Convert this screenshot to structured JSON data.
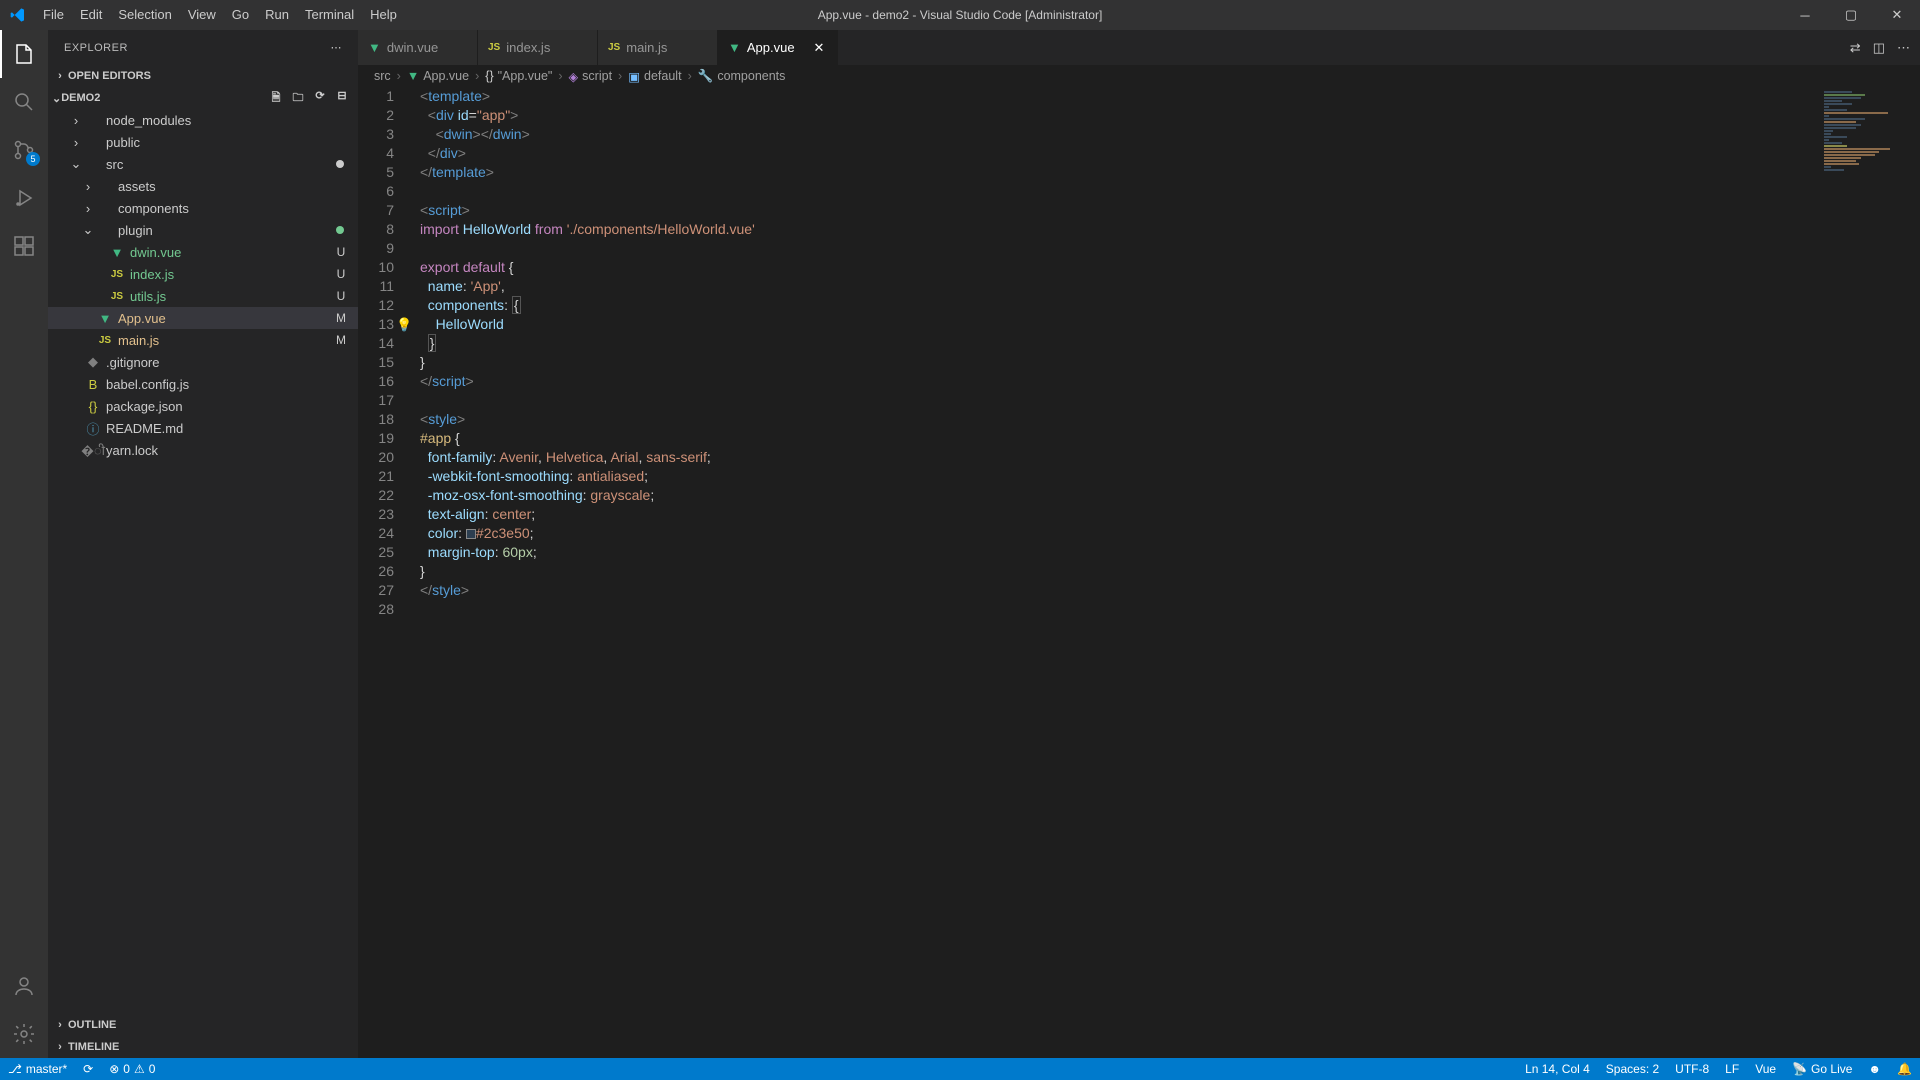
{
  "titlebar": {
    "title": "App.vue - demo2 - Visual Studio Code [Administrator]"
  },
  "menu": [
    "File",
    "Edit",
    "Selection",
    "View",
    "Go",
    "Run",
    "Terminal",
    "Help"
  ],
  "activity": {
    "scm_badge": "5"
  },
  "sidebar": {
    "title": "EXPLORER",
    "sections": {
      "open_editors": "OPEN EDITORS",
      "outline": "OUTLINE",
      "timeline": "TIMELINE"
    },
    "project": "DEMO2",
    "tree": [
      {
        "indent": 1,
        "type": "folder",
        "expanded": false,
        "label": "node_modules"
      },
      {
        "indent": 1,
        "type": "folder",
        "expanded": false,
        "label": "public"
      },
      {
        "indent": 1,
        "type": "folder",
        "expanded": true,
        "label": "src",
        "dot": true
      },
      {
        "indent": 2,
        "type": "folder",
        "expanded": false,
        "label": "assets"
      },
      {
        "indent": 2,
        "type": "folder",
        "expanded": false,
        "label": "components"
      },
      {
        "indent": 2,
        "type": "folder",
        "expanded": true,
        "label": "plugin",
        "dot_green": true
      },
      {
        "indent": 3,
        "type": "vue",
        "label": "dwin.vue",
        "status": "U"
      },
      {
        "indent": 3,
        "type": "js",
        "label": "index.js",
        "status": "U"
      },
      {
        "indent": 3,
        "type": "js",
        "label": "utils.js",
        "status": "U"
      },
      {
        "indent": 2,
        "type": "vue",
        "label": "App.vue",
        "status": "M",
        "selected": true
      },
      {
        "indent": 2,
        "type": "js",
        "label": "main.js",
        "status": "M"
      },
      {
        "indent": 1,
        "type": "git",
        "label": ".gitignore"
      },
      {
        "indent": 1,
        "type": "babel",
        "label": "babel.config.js"
      },
      {
        "indent": 1,
        "type": "json",
        "label": "package.json"
      },
      {
        "indent": 1,
        "type": "md",
        "label": "README.md"
      },
      {
        "indent": 1,
        "type": "lock",
        "label": "yarn.lock"
      }
    ]
  },
  "tabs": [
    {
      "icon": "vue",
      "label": "dwin.vue"
    },
    {
      "icon": "js",
      "label": "index.js"
    },
    {
      "icon": "js",
      "label": "main.js"
    },
    {
      "icon": "vue",
      "label": "App.vue",
      "active": true
    }
  ],
  "breadcrumbs": [
    "src",
    "App.vue",
    "\"App.vue\"",
    "script",
    "default",
    "components"
  ],
  "code_lines": 28,
  "statusbar": {
    "branch": "master*",
    "errors": "0",
    "warnings": "0",
    "ln_col": "Ln 14, Col 4",
    "spaces": "Spaces: 2",
    "encoding": "UTF-8",
    "eol": "LF",
    "lang": "Vue",
    "golive": "Go Live"
  }
}
